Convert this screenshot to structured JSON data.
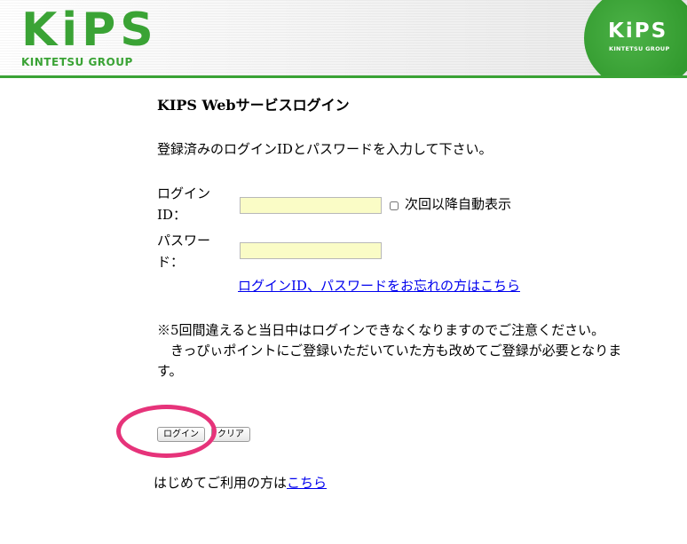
{
  "header": {
    "logo_left_word": "KiPS",
    "logo_left_group": "KINTETSU GROUP",
    "logo_right_word": "KiPS",
    "logo_right_group": "KINTETSU GROUP"
  },
  "colors": {
    "brand_green": "#3aa335",
    "highlight_circle": "#e6337a",
    "input_bg": "#fafcc6",
    "link": "#0000ee"
  },
  "login": {
    "title": "KIPS Webサービスログイン",
    "instruction": "登録済みのログインIDとパスワードを入力して下さい。",
    "id_label_line1": "ログイン",
    "id_label_line2": "ID：",
    "id_value": "",
    "password_label_line1": "パスワー",
    "password_label_line2": "ド：",
    "password_value": "",
    "auto_display_label": "次回以降自動表示",
    "forgot_link": "ログインID、パスワードをお忘れの方はこちら"
  },
  "notice": {
    "line1": "※5回間違えると当日中はログインできなくなりますのでご注意ください。",
    "line2": "きっぴぃポイントにご登録いただいていた方も改めてご登録が必要となります。"
  },
  "buttons": {
    "login": "ログイン",
    "clear": "クリア"
  },
  "footer": {
    "text": "はじめてご利用の方は",
    "link": "こちら"
  }
}
